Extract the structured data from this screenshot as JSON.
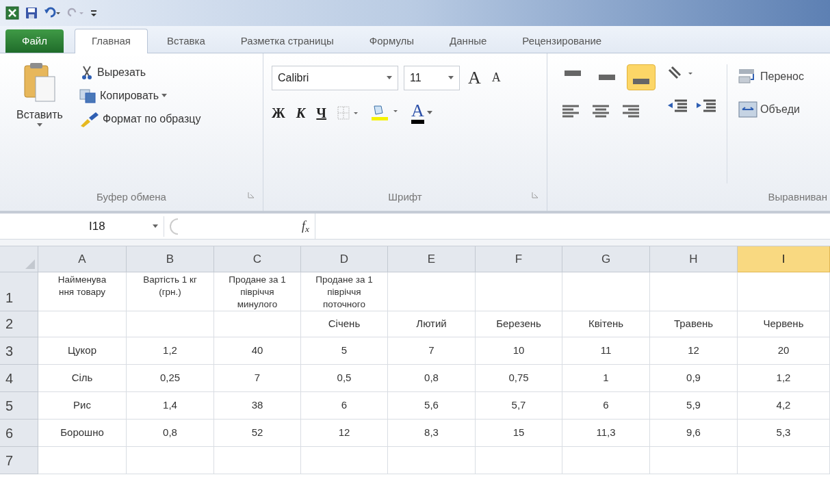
{
  "tabs": [
    {
      "label": "Файл",
      "kind": "file",
      "selected": false
    },
    {
      "label": "Главная",
      "kind": "tab",
      "selected": true
    },
    {
      "label": "Вставка",
      "kind": "tab",
      "selected": false
    },
    {
      "label": "Разметка страницы",
      "kind": "tab",
      "selected": false
    },
    {
      "label": "Формулы",
      "kind": "tab",
      "selected": false
    },
    {
      "label": "Данные",
      "kind": "tab",
      "selected": false
    },
    {
      "label": "Рецензирование",
      "kind": "tab",
      "selected": false
    }
  ],
  "clipboard": {
    "paste": "Вставить",
    "items": [
      "Вырезать",
      "Копировать",
      "Формат по образцу"
    ],
    "label": "Буфер обмена"
  },
  "font": {
    "name": "Calibri",
    "size": "11",
    "grow": "A",
    "shrink": "A",
    "styles": [
      "Ж",
      "К",
      "Ч"
    ],
    "font_color": "A",
    "label": "Шрифт"
  },
  "alignment": {
    "vertical": [
      {
        "selected": false
      },
      {
        "selected": false
      },
      {
        "selected": true
      }
    ],
    "wrap": "Перенос",
    "merge": "Объеди",
    "label": "Выравниван"
  },
  "formula_bar": {
    "name_box": "I18",
    "fx": "f$_{x}$"
  },
  "columns": [
    {
      "label": "A",
      "selected": false
    },
    {
      "label": "B",
      "selected": false
    },
    {
      "label": "C",
      "selected": false
    },
    {
      "label": "D",
      "selected": false
    },
    {
      "label": "E",
      "selected": false
    },
    {
      "label": "F",
      "selected": false
    },
    {
      "label": "G",
      "selected": false
    },
    {
      "label": "H",
      "selected": false
    },
    {
      "label": "I",
      "selected": true
    }
  ],
  "rows": [
    {
      "number": "1",
      "cells": [
        "Найменува ння товару",
        "Вартість 1 кг (грн.)",
        "Продане за 1 півріччя минулого",
        "Продане за 1 півріччя поточного"
      ]
    },
    {
      "number": "2",
      "cells": [
        null,
        null,
        null,
        "Січень",
        "Лютий",
        "Березень",
        "Квітень",
        "Травень",
        "Червень"
      ]
    },
    {
      "number": "3",
      "cells": [
        "Цукор",
        "1,2",
        "40",
        "5",
        "7",
        "10",
        "11",
        "12",
        "20"
      ]
    },
    {
      "number": "4",
      "cells": [
        "Сіль",
        "0,25",
        "7",
        "0,5",
        "0,8",
        "0,75",
        "1",
        "0,9",
        "1,2"
      ]
    },
    {
      "number": "5",
      "cells": [
        "Рис",
        "1,4",
        "38",
        "6",
        "5,6",
        "5,7",
        "6",
        "5,9",
        "4,2"
      ]
    },
    {
      "number": "6",
      "cells": [
        "Борошно",
        "0,8",
        "52",
        "12",
        "8,3",
        "15",
        "11,3",
        "9,6",
        "5,3"
      ]
    },
    {
      "number": "7"
    }
  ]
}
